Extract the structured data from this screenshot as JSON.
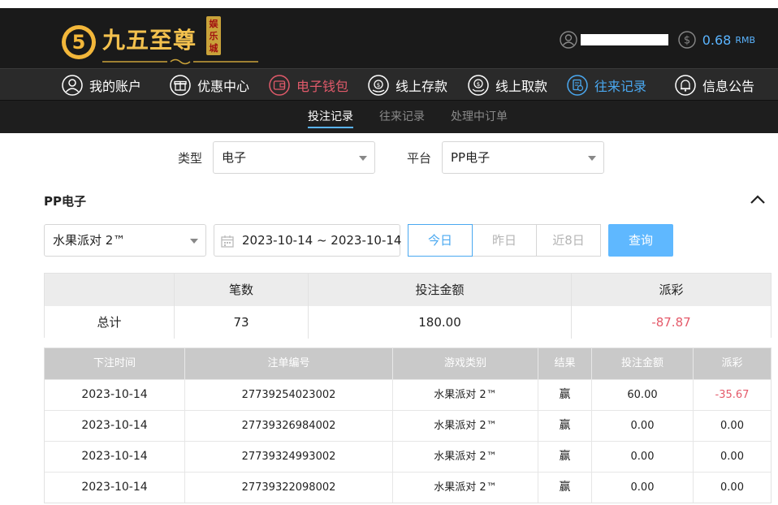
{
  "brand": {
    "name": "九五至尊",
    "seal": "娱乐城",
    "mark_char": "5"
  },
  "account": {
    "balance": "0.68",
    "currency": "RMB"
  },
  "nav": [
    {
      "label": "我的账户",
      "icon": "user-icon"
    },
    {
      "label": "优惠中心",
      "icon": "gift-icon"
    },
    {
      "label": "电子钱包",
      "icon": "wallet-icon"
    },
    {
      "label": "线上存款",
      "icon": "deposit-icon"
    },
    {
      "label": "线上取款",
      "icon": "withdraw-icon"
    },
    {
      "label": "往来记录",
      "icon": "records-icon"
    },
    {
      "label": "信息公告",
      "icon": "bell-icon"
    }
  ],
  "subtabs": [
    "投注记录",
    "往来记录",
    "处理中订单"
  ],
  "filters": {
    "type_label": "类型",
    "type_value": "电子",
    "platform_label": "平台",
    "platform_value": "PP电子"
  },
  "section": {
    "title": "PP电子"
  },
  "query": {
    "game_value": "水果派对 2™",
    "date_range": "2023-10-14 ~ 2023-10-14",
    "quick": [
      "今日",
      "昨日",
      "近8日"
    ],
    "button": "查询"
  },
  "summary": {
    "headers": [
      "",
      "笔数",
      "投注金额",
      "派彩"
    ],
    "label": "总计",
    "count": "73",
    "bet": "180.00",
    "payout": "-87.87"
  },
  "records": {
    "headers": [
      "下注时间",
      "注单编号",
      "游戏类别",
      "结果",
      "投注金额",
      "派彩"
    ],
    "rows": [
      [
        "2023-10-14",
        "27739254023002",
        "水果派对 2™",
        "赢",
        "60.00",
        "-35.67"
      ],
      [
        "2023-10-14",
        "27739326984002",
        "水果派对 2™",
        "赢",
        "0.00",
        "0.00"
      ],
      [
        "2023-10-14",
        "27739324993002",
        "水果派对 2™",
        "赢",
        "0.00",
        "0.00"
      ],
      [
        "2023-10-14",
        "27739322098002",
        "水果派对 2™",
        "赢",
        "0.00",
        "0.00"
      ]
    ]
  },
  "colors": {
    "accent_blue": "#4aa8f0",
    "negative_red": "#e45a6a",
    "brand_gold": "#f3c14e"
  }
}
